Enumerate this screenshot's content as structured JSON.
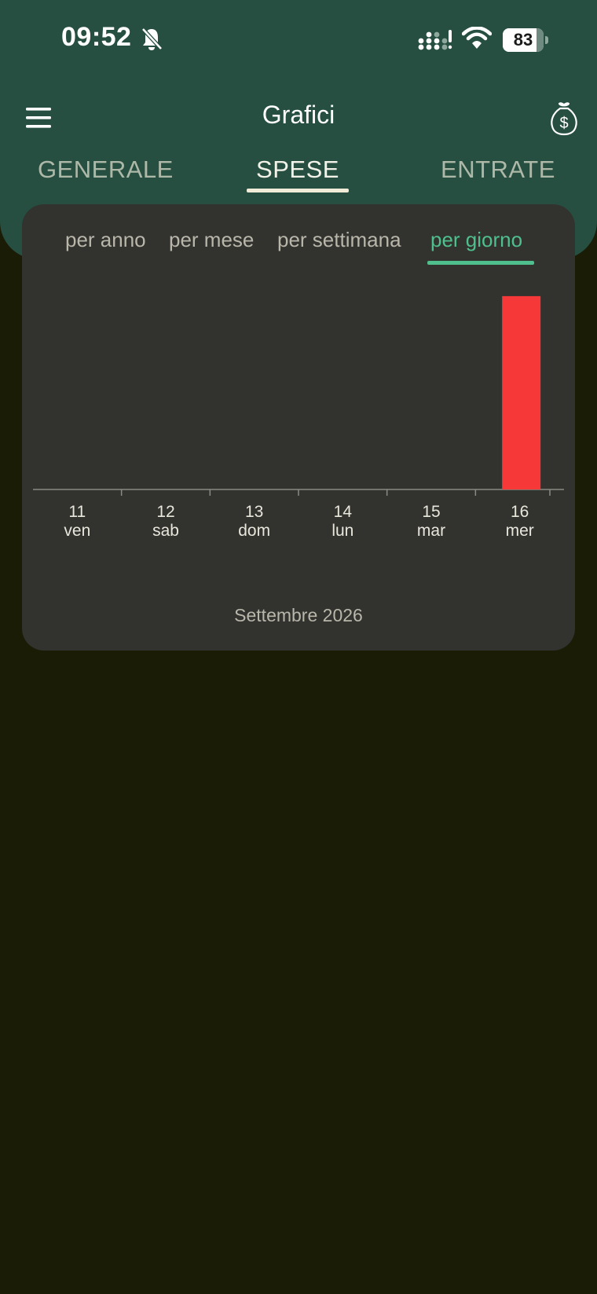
{
  "status_bar": {
    "time": "09:52",
    "battery": "83",
    "battery_level": 0.83,
    "icons": [
      "bell-muted-icon",
      "signal-icon",
      "wifi-icon",
      "battery-icon"
    ]
  },
  "app_bar": {
    "title": "Grafici",
    "menu_icon": "menu-icon",
    "action_icon": "money-bag-icon"
  },
  "tabs": [
    {
      "label": "GENERALE",
      "active": false
    },
    {
      "label": "SPESE",
      "active": true
    },
    {
      "label": "ENTRATE",
      "active": false
    }
  ],
  "period_tabs": [
    {
      "label": "per anno",
      "active": false
    },
    {
      "label": "per mese",
      "active": false
    },
    {
      "label": "per settimana",
      "active": false
    },
    {
      "label": "per giorno",
      "active": true
    }
  ],
  "colors": {
    "header": "#264f41",
    "background": "#1a1c06",
    "card": "#32322f",
    "accent": "#4fc08d",
    "bar": "#f63839"
  },
  "chart_data": {
    "type": "bar",
    "categories": [
      "11",
      "12",
      "13",
      "14",
      "15",
      "16"
    ],
    "category_sublabels": [
      "ven",
      "sab",
      "dom",
      "lun",
      "mar",
      "mer"
    ],
    "values": [
      0,
      0,
      0,
      0,
      0,
      1
    ],
    "xlabel": "Settembre 2026",
    "ylim": [
      0,
      1.15
    ],
    "grid": false,
    "bar_color": "#f63839"
  }
}
